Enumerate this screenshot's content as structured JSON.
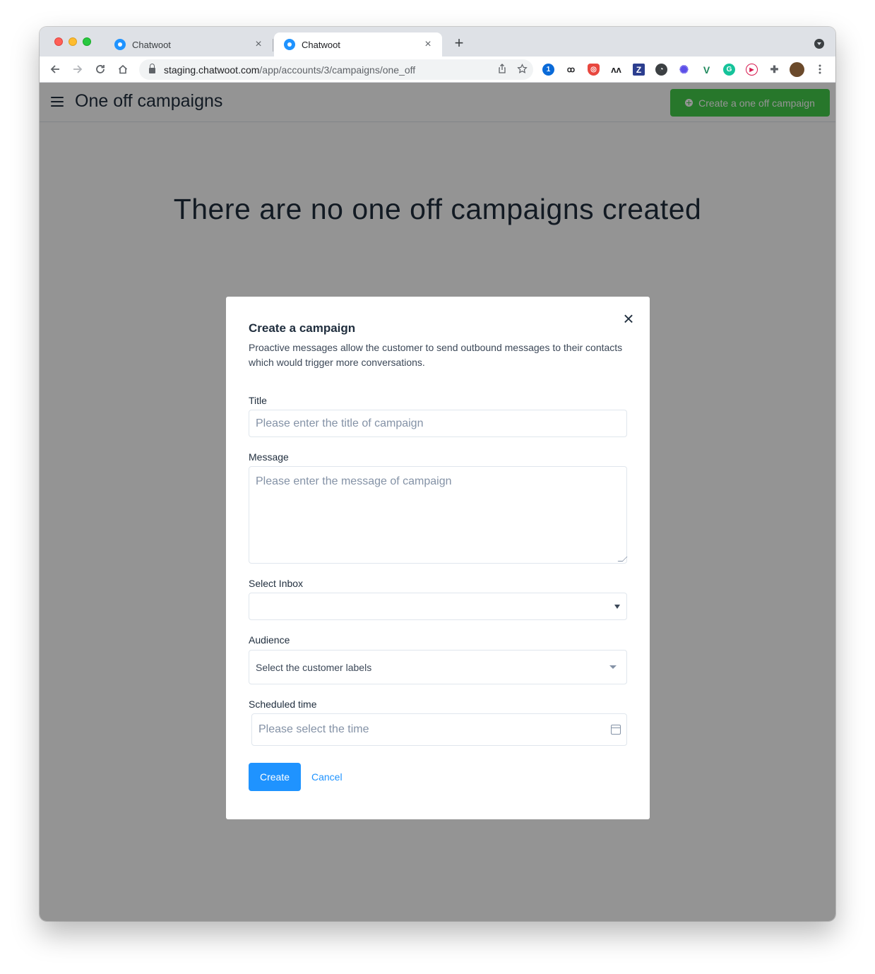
{
  "browser": {
    "tabs": [
      {
        "title": "Chatwoot",
        "active": false
      },
      {
        "title": "Chatwoot",
        "active": true
      }
    ],
    "tab_close_glyph": "×",
    "new_tab_glyph": "+",
    "url_host": "staging.chatwoot.com",
    "url_path": "/app/accounts/3/campaigns/one_off",
    "extension_icons": [
      "1password-icon",
      "glasses-icon",
      "shield-icon",
      "wave-icon",
      "z-icon",
      "clock-icon",
      "gear-icon",
      "vue-icon",
      "grammarly-icon",
      "play-icon",
      "puzzle-icon",
      "avatar"
    ]
  },
  "header": {
    "title": "One off campaigns",
    "create_button_label": "Create a one off campaign"
  },
  "main": {
    "empty_state": "There are no one off campaigns created"
  },
  "modal": {
    "title": "Create a campaign",
    "description": "Proactive messages allow the customer to send outbound messages to their contacts which would trigger more conversations.",
    "close_glyph": "×",
    "fields": {
      "title_label": "Title",
      "title_placeholder": "Please enter the title of campaign",
      "message_label": "Message",
      "message_placeholder": "Please enter the message of campaign",
      "inbox_label": "Select Inbox",
      "inbox_value": "",
      "audience_label": "Audience",
      "audience_placeholder": "Select the customer labels",
      "time_label": "Scheduled time",
      "time_placeholder": "Please select the time"
    },
    "create_label": "Create",
    "cancel_label": "Cancel"
  },
  "colors": {
    "brand_blue": "#1f93ff",
    "success_green": "#44ce4b",
    "overlay": "rgba(0,0,0,0.42)"
  }
}
